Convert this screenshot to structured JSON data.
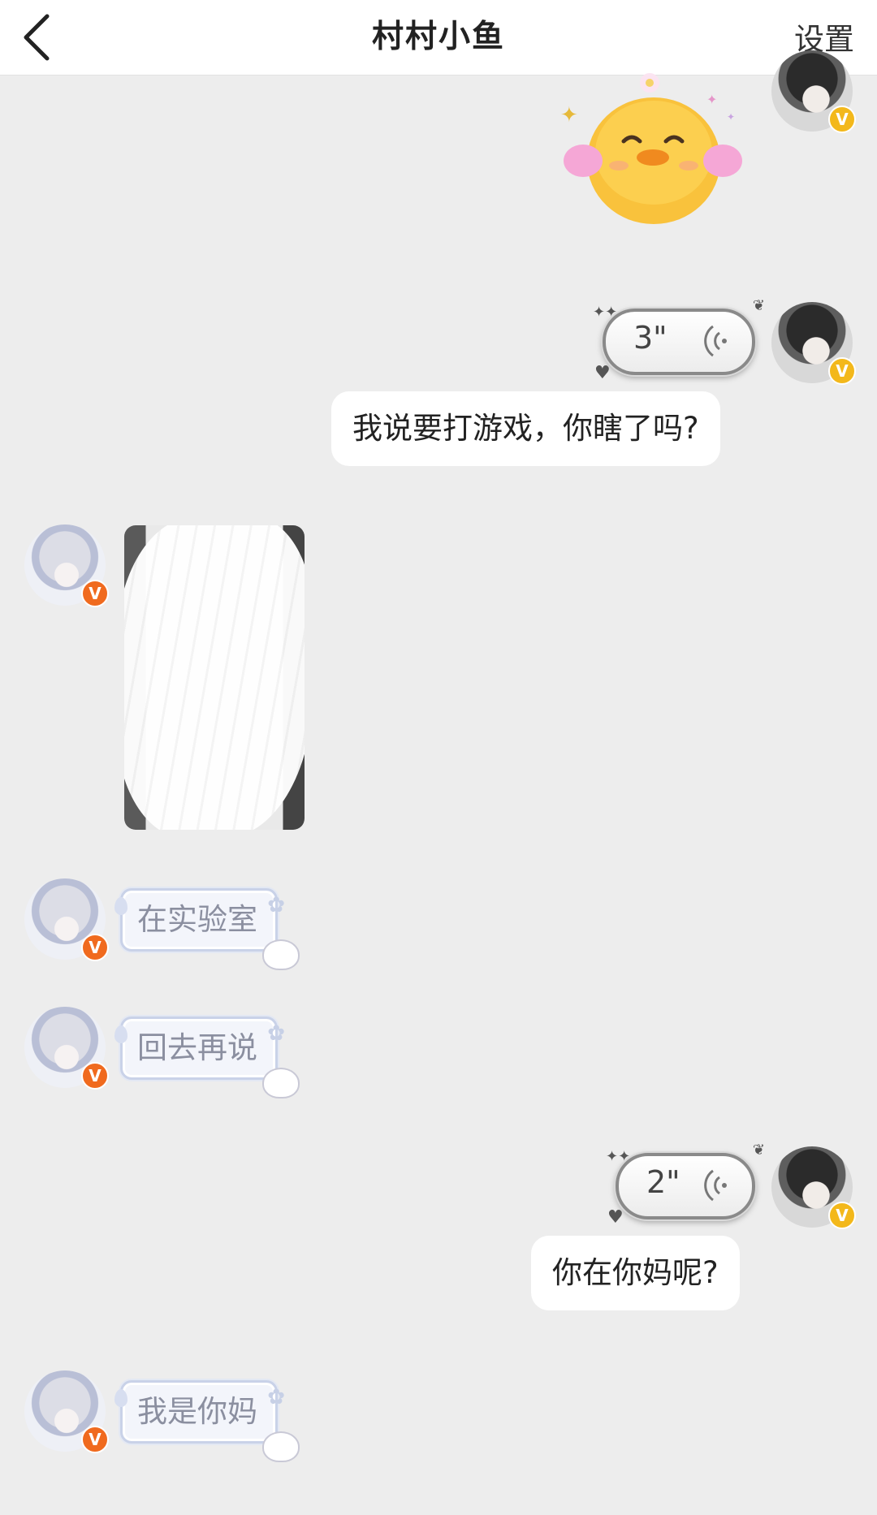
{
  "header": {
    "title": "村村小鱼",
    "settings_label": "设置",
    "back_icon": "chevron-left-icon"
  },
  "messages": [
    {
      "side": "right",
      "type": "sticker",
      "sticker": "yellow-duck-sticker"
    },
    {
      "side": "right",
      "type": "voice",
      "duration": "3\""
    },
    {
      "side": "right",
      "type": "text",
      "text": "我说要打游戏，你瞎了吗?"
    },
    {
      "side": "left",
      "type": "image",
      "content": "scribbled-out-photo"
    },
    {
      "side": "left",
      "type": "text",
      "text": "在实验室"
    },
    {
      "side": "left",
      "type": "text",
      "text": "回去再说"
    },
    {
      "side": "right",
      "type": "voice",
      "duration": "2\""
    },
    {
      "side": "right",
      "type": "text",
      "text": "你在你妈呢?"
    },
    {
      "side": "left",
      "type": "text",
      "text": "我是你妈"
    }
  ],
  "badge_letter": "V",
  "colors": {
    "background": "#ededed",
    "male_badge": "#f3b81b",
    "female_badge": "#f06a1e"
  }
}
